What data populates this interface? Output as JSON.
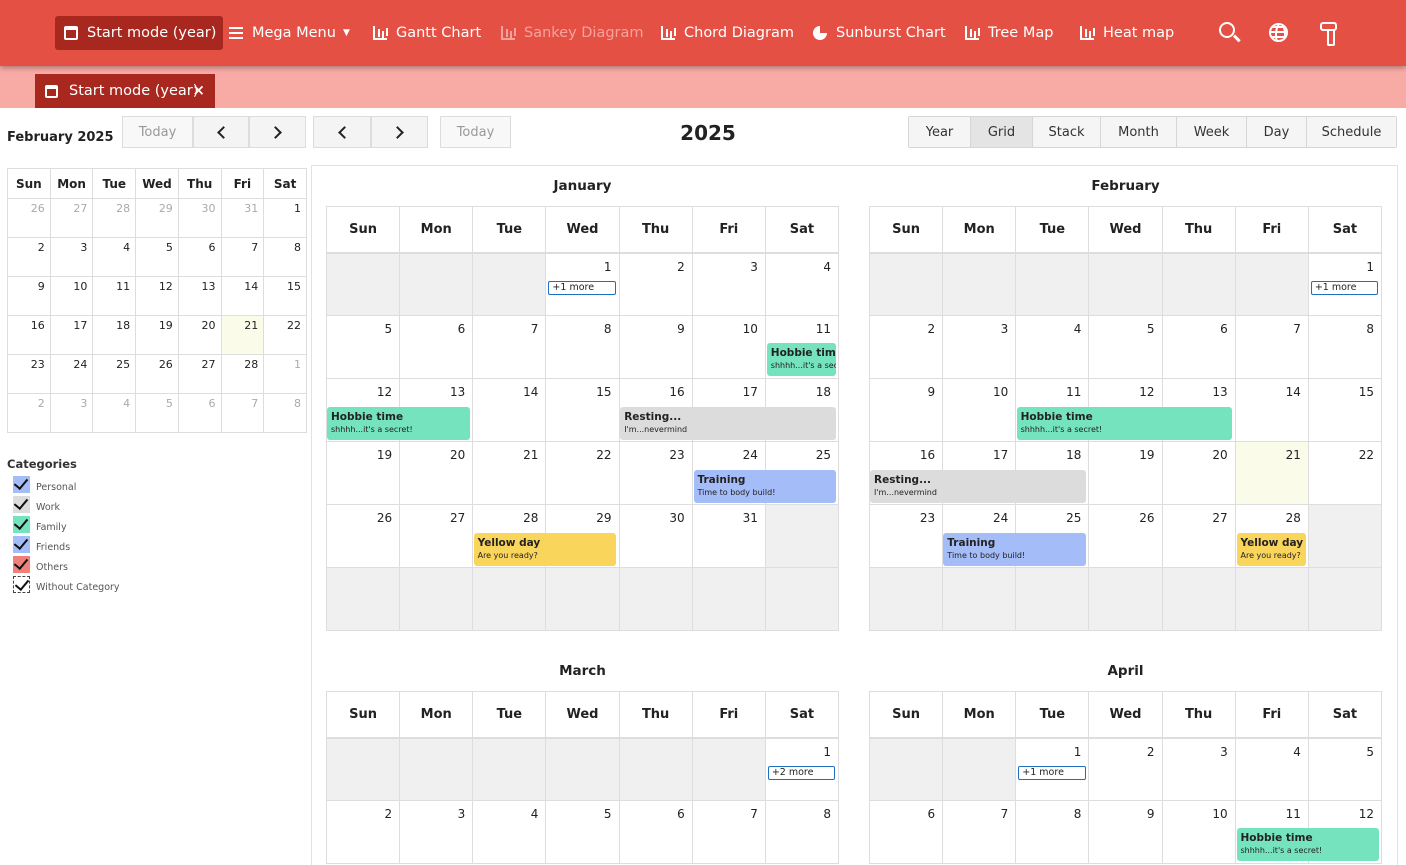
{
  "nav": {
    "items": [
      {
        "label": "Start mode (year)",
        "icon": "calendar-icon",
        "active": true
      },
      {
        "label": "Mega Menu",
        "icon": "menu-icon"
      },
      {
        "label": "Gantt Chart",
        "icon": "chart-icon"
      },
      {
        "label": "Sankey Diagram",
        "icon": "chart-icon",
        "disabled": true
      },
      {
        "label": "Chord Diagram",
        "icon": "chart-icon"
      },
      {
        "label": "Sunburst Chart",
        "icon": "pie-icon"
      },
      {
        "label": "Tree Map",
        "icon": "chart-icon"
      },
      {
        "label": "Heat map",
        "icon": "chart-icon"
      }
    ],
    "icons": [
      "search-icon",
      "globe-icon",
      "paint-roller-icon"
    ]
  },
  "tab": {
    "label": "Start mode (year)",
    "close": "×"
  },
  "mini": {
    "title": "February 2025",
    "today_label": "Today",
    "weekdays": [
      "Sun",
      "Mon",
      "Tue",
      "Wed",
      "Thu",
      "Fri",
      "Sat"
    ],
    "weeks": [
      [
        "26",
        "27",
        "28",
        "29",
        "30",
        "31",
        "1"
      ],
      [
        "2",
        "3",
        "4",
        "5",
        "6",
        "7",
        "8"
      ],
      [
        "9",
        "10",
        "11",
        "12",
        "13",
        "14",
        "15"
      ],
      [
        "16",
        "17",
        "18",
        "19",
        "20",
        "21",
        "22"
      ],
      [
        "23",
        "24",
        "25",
        "26",
        "27",
        "28",
        "1"
      ],
      [
        "2",
        "3",
        "4",
        "5",
        "6",
        "7",
        "8"
      ]
    ]
  },
  "toolbar": {
    "today_label": "Today",
    "title": "2025",
    "views": [
      "Year",
      "Grid",
      "Stack",
      "Month",
      "Week",
      "Day",
      "Schedule"
    ],
    "active_view": "Grid"
  },
  "categories": {
    "title": "Categories",
    "items": [
      {
        "label": "Personal",
        "color": "#a4bcf7"
      },
      {
        "label": "Work",
        "color": "#dcdcdc"
      },
      {
        "label": "Family",
        "color": "#75e3bd"
      },
      {
        "label": "Friends",
        "color": "#a4bcf7"
      },
      {
        "label": "Others",
        "color": "#f0807a"
      },
      {
        "label": "Without Category",
        "color": "#ffffff"
      }
    ]
  },
  "weekdays": [
    "Sun",
    "Mon",
    "Tue",
    "Wed",
    "Thu",
    "Fri",
    "Sat"
  ],
  "months": [
    {
      "name": "January",
      "weeks": [
        [
          "",
          "",
          "",
          "1",
          "2",
          "3",
          "4"
        ],
        [
          "5",
          "6",
          "7",
          "8",
          "9",
          "10",
          "11"
        ],
        [
          "12",
          "13",
          "14",
          "15",
          "16",
          "17",
          "18"
        ],
        [
          "19",
          "20",
          "21",
          "22",
          "23",
          "24",
          "25"
        ],
        [
          "26",
          "27",
          "28",
          "29",
          "30",
          "31",
          ""
        ],
        [
          "",
          "",
          "",
          "",
          "",
          "",
          ""
        ]
      ],
      "more": [
        {
          "week": 0,
          "col": 3,
          "label": "+1 more"
        }
      ],
      "events": [
        {
          "week": 1,
          "col": 6,
          "span": 1,
          "title": "Hobbie time",
          "desc": "shhhh...it's a secret!",
          "color": "#75e3bd"
        },
        {
          "week": 2,
          "col": 0,
          "span": 2,
          "title": "Hobbie time",
          "desc": "shhhh...it's a secret!",
          "color": "#75e3bd"
        },
        {
          "week": 2,
          "col": 4,
          "span": 3,
          "title": "Resting...",
          "desc": "I'm...nevermind",
          "color": "#dcdcdc"
        },
        {
          "week": 3,
          "col": 5,
          "span": 2,
          "title": "Training",
          "desc": "Time to body build!",
          "color": "#a4bcf7"
        },
        {
          "week": 4,
          "col": 2,
          "span": 2,
          "title": "Yellow day",
          "desc": "Are you ready?",
          "color": "#fad55c"
        }
      ]
    },
    {
      "name": "February",
      "weeks": [
        [
          "",
          "",
          "",
          "",
          "",
          "",
          "1"
        ],
        [
          "2",
          "3",
          "4",
          "5",
          "6",
          "7",
          "8"
        ],
        [
          "9",
          "10",
          "11",
          "12",
          "13",
          "14",
          "15"
        ],
        [
          "16",
          "17",
          "18",
          "19",
          "20",
          "21",
          "22"
        ],
        [
          "23",
          "24",
          "25",
          "26",
          "27",
          "28",
          ""
        ],
        [
          "",
          "",
          "",
          "",
          "",
          "",
          ""
        ]
      ],
      "today": [
        3,
        5
      ],
      "more": [
        {
          "week": 0,
          "col": 6,
          "label": "+1 more"
        }
      ],
      "events": [
        {
          "week": 2,
          "col": 2,
          "span": 3,
          "title": "Hobbie time",
          "desc": "shhhh...it's a secret!",
          "color": "#75e3bd"
        },
        {
          "week": 3,
          "col": 0,
          "span": 3,
          "title": "Resting...",
          "desc": "I'm...nevermind",
          "color": "#dcdcdc"
        },
        {
          "week": 4,
          "col": 1,
          "span": 2,
          "title": "Training",
          "desc": "Time to body build!",
          "color": "#a4bcf7"
        },
        {
          "week": 4,
          "col": 5,
          "span": 1,
          "title": "Yellow day",
          "desc": "Are you ready?",
          "color": "#fad55c"
        }
      ]
    },
    {
      "name": "March",
      "weeks": [
        [
          "",
          "",
          "",
          "",
          "",
          "",
          "1"
        ],
        [
          "2",
          "3",
          "4",
          "5",
          "6",
          "7",
          "8"
        ]
      ],
      "more": [
        {
          "week": 0,
          "col": 6,
          "label": "+2 more"
        }
      ],
      "events": []
    },
    {
      "name": "April",
      "weeks": [
        [
          "",
          "",
          "1",
          "2",
          "3",
          "4",
          "5"
        ],
        [
          "6",
          "7",
          "8",
          "9",
          "10",
          "11",
          "12"
        ]
      ],
      "more": [
        {
          "week": 0,
          "col": 2,
          "label": "+1 more"
        }
      ],
      "events": [
        {
          "week": 1,
          "col": 5,
          "span": 2,
          "title": "Hobbie time",
          "desc": "shhhh...it's a secret!",
          "color": "#75e3bd"
        }
      ]
    }
  ]
}
